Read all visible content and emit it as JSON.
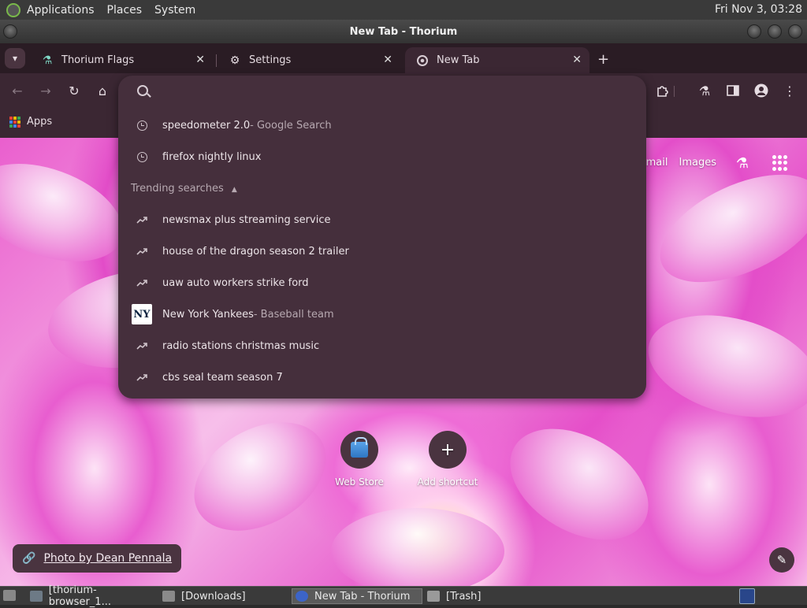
{
  "topbar": {
    "menus": [
      "Applications",
      "Places",
      "System"
    ],
    "clock": "Fri Nov  3, 03:28"
  },
  "window": {
    "title": "New Tab - Thorium"
  },
  "tabs": [
    {
      "label": "Thorium Flags",
      "icon": "flask-icon"
    },
    {
      "label": "Settings",
      "icon": "gear-icon"
    },
    {
      "label": "New Tab",
      "icon": "thorium-icon",
      "active": true
    }
  ],
  "bookmarks": {
    "apps_label": "Apps"
  },
  "omnibox": {
    "history": [
      {
        "text": "speedometer 2.0",
        "suffix": " - Google Search"
      },
      {
        "text": "firefox nightly linux",
        "suffix": ""
      }
    ],
    "trending_header": "Trending searches",
    "trending": [
      {
        "text": "newsmax plus streaming service",
        "suffix": "",
        "icon": "trend-icon"
      },
      {
        "text": "house of the dragon season 2 trailer",
        "suffix": "",
        "icon": "trend-icon"
      },
      {
        "text": "uaw auto workers strike ford",
        "suffix": "",
        "icon": "trend-icon"
      },
      {
        "text": "New York Yankees",
        "suffix": " - Baseball team",
        "icon": "yankees-logo"
      },
      {
        "text": "radio stations christmas music",
        "suffix": "",
        "icon": "trend-icon"
      },
      {
        "text": "cbs seal team season 7",
        "suffix": "",
        "icon": "trend-icon"
      }
    ]
  },
  "ntp": {
    "gmail": "Gmail",
    "images": "Images",
    "shortcuts": [
      {
        "label": "Web Store"
      },
      {
        "label": "Add shortcut"
      }
    ],
    "photo_credit": "Photo by Dean Pennala"
  },
  "taskbar": {
    "tasks": [
      {
        "label": "[thorium-browser_1..."
      },
      {
        "label": "[Downloads]"
      },
      {
        "label": "New Tab - Thorium",
        "active": true
      },
      {
        "label": "[Trash]"
      }
    ]
  }
}
